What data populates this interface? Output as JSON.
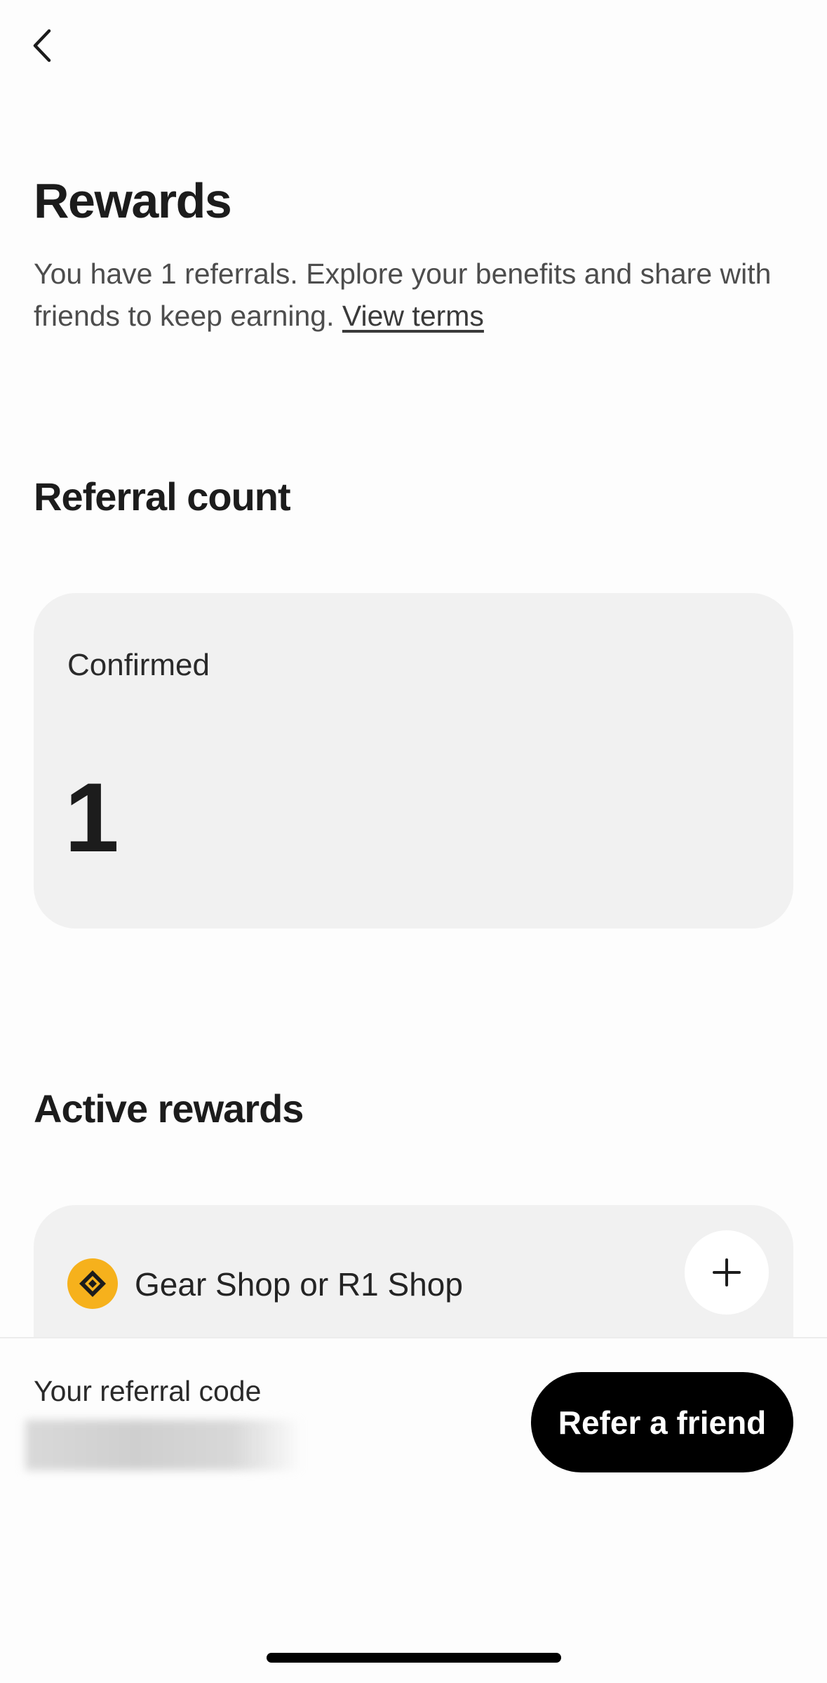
{
  "header": {
    "back_icon": "chevron-left-icon"
  },
  "page": {
    "title": "Rewards",
    "intro_text": "You have 1 referrals. Explore your benefits and share with friends to keep earning.",
    "view_terms_link": "View terms"
  },
  "referral_count": {
    "section_title": "Referral count",
    "card": {
      "label": "Confirmed",
      "value": "1"
    }
  },
  "active_rewards": {
    "section_title": "Active rewards",
    "items": [
      {
        "label": "Gear Shop or R1 Shop",
        "icon": "shop-diamond-icon",
        "icon_color": "#f6b11c",
        "action_icon": "plus-icon"
      }
    ]
  },
  "footer": {
    "code_label": "Your referral code",
    "code_value": "",
    "refer_button_label": "Refer a friend"
  },
  "colors": {
    "background": "#fdfdfd",
    "card": "#f1f1f1",
    "button_bg": "#000000",
    "button_text": "#ffffff",
    "accent": "#f6b11c"
  }
}
